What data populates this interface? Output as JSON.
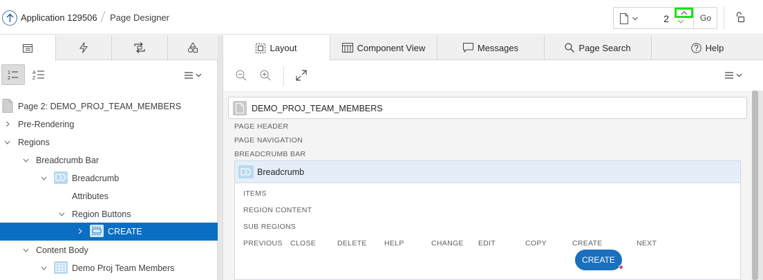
{
  "header": {
    "app_name": "Application 129506",
    "page_designer": "Page Designer",
    "page_number": "2",
    "go_label": "Go"
  },
  "left_tabs": [
    "rendering-tab",
    "dynamic-actions-tab",
    "processing-tab",
    "shared-components-tab"
  ],
  "tree": {
    "page": "Page 2: DEMO_PROJ_TEAM_MEMBERS",
    "pre_rendering": "Pre-Rendering",
    "regions": "Regions",
    "breadcrumb_bar": "Breadcrumb Bar",
    "breadcrumb": "Breadcrumb",
    "attributes": "Attributes",
    "region_buttons": "Region Buttons",
    "create": "CREATE",
    "content_body": "Content Body",
    "demo_proj": "Demo Proj Team Members"
  },
  "right_tabs": {
    "layout": "Layout",
    "component_view": "Component View",
    "messages": "Messages",
    "page_search": "Page Search",
    "help": "Help"
  },
  "canvas": {
    "page_card": "DEMO_PROJ_TEAM_MEMBERS",
    "page_header": "PAGE HEADER",
    "page_navigation": "PAGE NAVIGATION",
    "breadcrumb_bar": "BREADCRUMB BAR",
    "region_title": "Breadcrumb",
    "items": "ITEMS",
    "region_content": "REGION CONTENT",
    "sub_regions": "SUB REGIONS",
    "button_positions": {
      "previous": "PREVIOUS",
      "close": "CLOSE",
      "delete": "DELETE",
      "help": "HELP",
      "change": "CHANGE",
      "edit": "EDIT",
      "copy": "COPY",
      "create": "CREATE",
      "next": "NEXT"
    },
    "create_button": "CREATE"
  },
  "colors": {
    "selected_row": "#0a6ec2",
    "create_button": "#1a6fbf",
    "spinner_highlight": "#1ee01e"
  }
}
